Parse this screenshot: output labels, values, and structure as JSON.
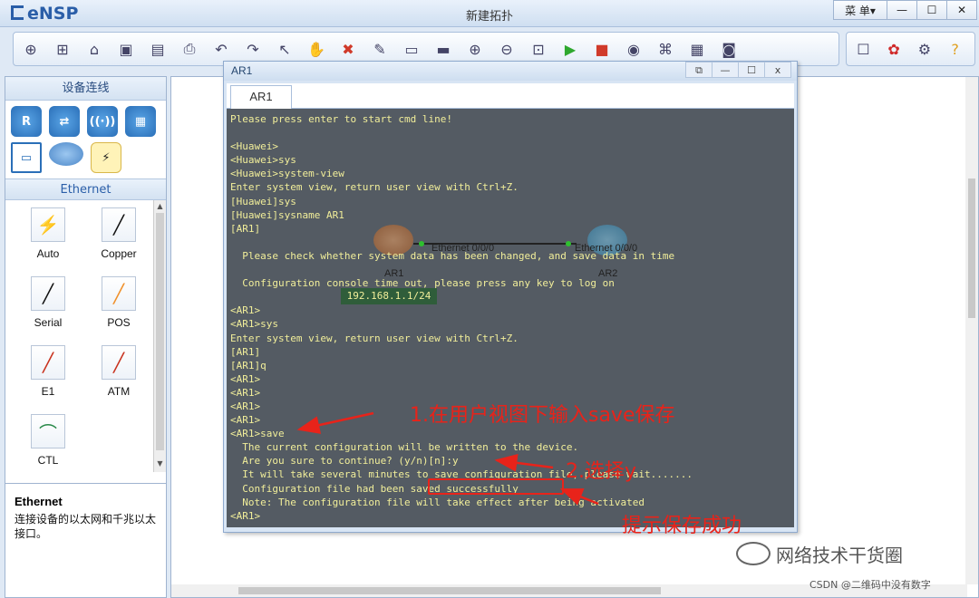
{
  "app": {
    "logo_text": "eNSP",
    "title": "新建拓扑",
    "menu_label": "菜 单▾",
    "min_label": "—",
    "max_label": "☐",
    "close_label": "✕"
  },
  "toolbar_icons": [
    "new-topology-icon",
    "new-example-icon",
    "open-icon",
    "save-icon",
    "save-as-icon",
    "print-icon",
    "undo-icon",
    "redo-icon",
    "select-icon",
    "pan-icon",
    "delete-icon",
    "delete-link-icon",
    "text-icon",
    "palette-icon",
    "zoom-in-icon",
    "zoom-out-icon",
    "fit-icon",
    "start-icon",
    "stop-icon",
    "capture-icon",
    "topology-icon",
    "grid-icon",
    "console-icon"
  ],
  "toolbar_right_icons": [
    "chat-icon",
    "huawei-icon",
    "settings-icon",
    "help-icon"
  ],
  "left_panel": {
    "header": "设备连线",
    "ethernet_header": "Ethernet",
    "cables": [
      {
        "label": "Auto",
        "glyph": "⚡"
      },
      {
        "label": "Copper",
        "glyph": "╱"
      },
      {
        "label": "Serial",
        "glyph": "╱"
      },
      {
        "label": "POS",
        "glyph": "╱"
      },
      {
        "label": "E1",
        "glyph": "╱"
      },
      {
        "label": "ATM",
        "glyph": "╱"
      },
      {
        "label": "CTL",
        "glyph": "⌒"
      }
    ],
    "desc_title": "Ethernet",
    "desc_text": "连接设备的以太网和千兆以太接口。"
  },
  "console": {
    "window_title": "AR1",
    "tab_label": "AR1",
    "lines": [
      "Please press enter to start cmd line!",
      "",
      "<Huawei>",
      "<Huawei>sys",
      "<Huawei>system-view",
      "Enter system view, return user view with Ctrl+Z.",
      "[Huawei]sys",
      "[Huawei]sysname AR1",
      "[AR1]",
      "",
      "  Please check whether system data has been changed, and save data in time",
      "",
      "  Configuration console time out, please press any key to log on",
      "",
      "<AR1>",
      "<AR1>sys",
      "Enter system view, return user view with Ctrl+Z.",
      "[AR1]",
      "[AR1]q",
      "<AR1>",
      "<AR1>",
      "<AR1>",
      "<AR1>",
      "<AR1>save",
      "  The current configuration will be written to the device.",
      "  Are you sure to continue? (y/n)[n]:y",
      "  It will take several minutes to save configuration file, please wait.......",
      "  Configuration file had been saved successfully",
      "  Note: The configuration file will take effect after being activated",
      "<AR1>"
    ]
  },
  "topology": {
    "node1_label": "AR1",
    "node2_label": "AR2",
    "port1_label": "Ethernet 0/0/0",
    "port2_label": "Ethernet 0/0/0",
    "ip_label": "192.168.1.1/24"
  },
  "annotations": {
    "step1": "1.在用户视图下输入save保存",
    "step2": "2.选择y",
    "step3": "提示保存成功",
    "color": "#e8231a"
  },
  "watermark": {
    "name": "网络技术干货圈",
    "csdn": "CSDN @二维码中没有数字"
  }
}
